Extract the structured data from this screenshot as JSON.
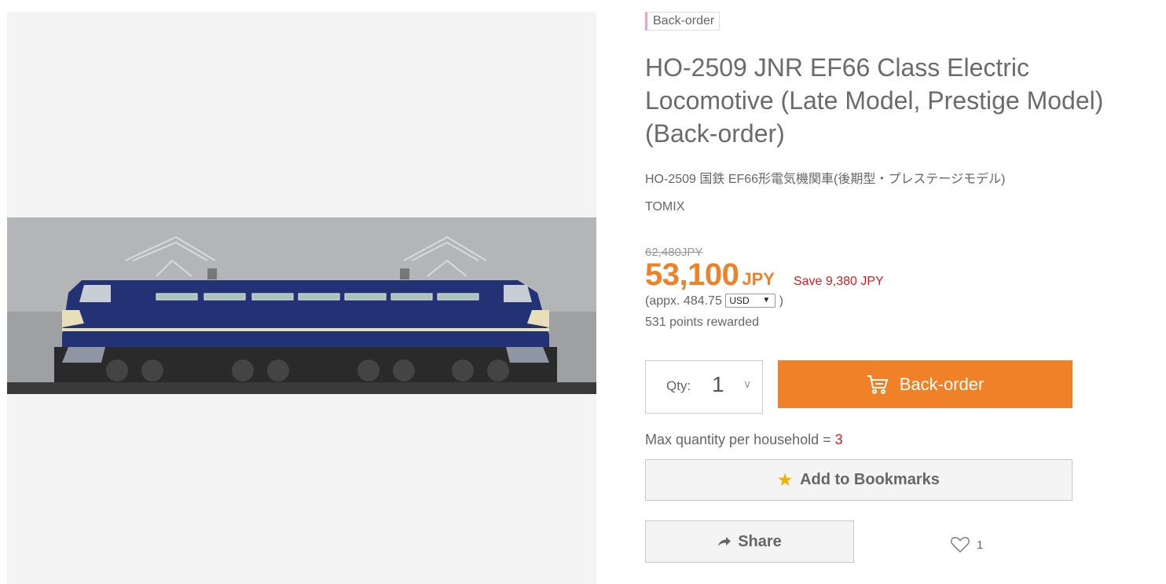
{
  "product": {
    "status_badge": "Back-order",
    "title": "HO-2509 JNR EF66 Class Electric Locomotive (Late Model, Prestige Model) (Back-order)",
    "japanese_name": "HO-2509 国鉄 EF66形電気機関車(後期型・プレステージモデル)",
    "manufacturer": "TOMIX",
    "image_alt": "HO-2509 JNR EF66 Class Electric Locomotive"
  },
  "pricing": {
    "original_price": "62,480JPY",
    "price": "53,100",
    "currency": "JPY",
    "save_text": "Save 9,380 JPY",
    "approx_prefix": "(appx. 484.75",
    "approx_suffix": ")",
    "approx_currency": "USD",
    "points": "531 points rewarded"
  },
  "purchase": {
    "qty_label": "Qty:",
    "qty_value": "1",
    "button_label": "Back-order",
    "max_qty_label": "Max quantity per household = ",
    "max_qty_value": "3"
  },
  "actions": {
    "bookmark_label": "Add to Bookmarks",
    "share_label": "Share",
    "like_count": "1"
  },
  "colors": {
    "accent_orange": "#f08129",
    "sale_red": "#e0181b",
    "badge_pink": "#f29fc8",
    "star_gold": "#f0b400"
  }
}
